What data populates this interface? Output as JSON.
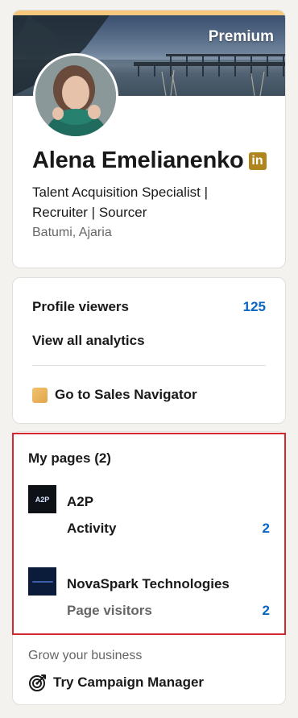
{
  "profile": {
    "premium_label": "Premium",
    "name": "Alena Emelianenko",
    "badge_text": "in",
    "headline": "Talent Acquisition Specialist | Recruiter | Sourcer",
    "location": "Batumi, Ajaria",
    "colors": {
      "premium_strip": "#f8c77e",
      "badge": "#b0851e"
    }
  },
  "analytics": {
    "profile_viewers_label": "Profile viewers",
    "profile_viewers_count": "125",
    "view_all_label": "View all analytics",
    "sales_navigator_label": "Go to Sales Navigator",
    "sales_navigator_icon": "sales-navigator-icon",
    "accent": "#0a66c2"
  },
  "pages": {
    "title": "My pages (2)",
    "items": [
      {
        "name": "A2P",
        "logo_text": "A2P",
        "stat_label": "Activity",
        "stat_value": "2"
      },
      {
        "name": "NovaSpark Technologies",
        "logo_text": "",
        "stat_label": "Page visitors",
        "stat_value": "2"
      }
    ],
    "grow_label": "Grow your business",
    "campaign_label": "Try Campaign Manager",
    "campaign_icon": "target-icon",
    "highlight_color": "#d3282f"
  }
}
